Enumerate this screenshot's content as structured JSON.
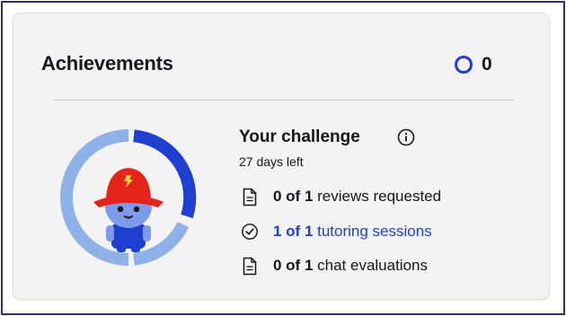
{
  "card": {
    "title": "Achievements",
    "count": "0"
  },
  "challenge": {
    "title": "Your challenge",
    "days_left": "27 days left"
  },
  "tasks": [
    {
      "progress": "0 of 1",
      "label": " reviews requested",
      "status": "pending",
      "icon": "document-icon"
    },
    {
      "progress": "1 of 1",
      "label": " tutoring sessions",
      "status": "complete",
      "icon": "checkmark-circle-icon"
    },
    {
      "progress": "0 of 1",
      "label": " chat evaluations",
      "status": "pending",
      "icon": "document-icon"
    }
  ],
  "badge": {
    "progress_fraction": 0.33,
    "icon": "mascot-with-red-bucket-hat"
  },
  "colors": {
    "accent": "#1f3fd1",
    "ring_light": "#8fb1e8",
    "hat_red": "#e5251b",
    "mascot_blue": "#7d9bea"
  }
}
